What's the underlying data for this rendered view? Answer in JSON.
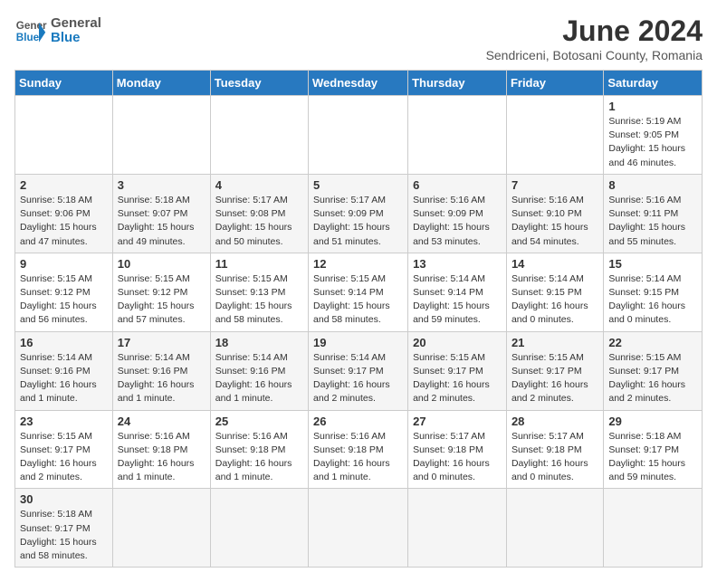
{
  "logo": {
    "text_general": "General",
    "text_blue": "Blue"
  },
  "title": {
    "month_year": "June 2024",
    "location": "Sendriceni, Botosani County, Romania"
  },
  "days_of_week": [
    "Sunday",
    "Monday",
    "Tuesday",
    "Wednesday",
    "Thursday",
    "Friday",
    "Saturday"
  ],
  "weeks": [
    [
      {
        "day": "",
        "info": ""
      },
      {
        "day": "",
        "info": ""
      },
      {
        "day": "",
        "info": ""
      },
      {
        "day": "",
        "info": ""
      },
      {
        "day": "",
        "info": ""
      },
      {
        "day": "",
        "info": ""
      },
      {
        "day": "1",
        "info": "Sunrise: 5:19 AM\nSunset: 9:05 PM\nDaylight: 15 hours\nand 46 minutes."
      }
    ],
    [
      {
        "day": "2",
        "info": "Sunrise: 5:18 AM\nSunset: 9:06 PM\nDaylight: 15 hours\nand 47 minutes."
      },
      {
        "day": "3",
        "info": "Sunrise: 5:18 AM\nSunset: 9:07 PM\nDaylight: 15 hours\nand 49 minutes."
      },
      {
        "day": "4",
        "info": "Sunrise: 5:17 AM\nSunset: 9:08 PM\nDaylight: 15 hours\nand 50 minutes."
      },
      {
        "day": "5",
        "info": "Sunrise: 5:17 AM\nSunset: 9:09 PM\nDaylight: 15 hours\nand 51 minutes."
      },
      {
        "day": "6",
        "info": "Sunrise: 5:16 AM\nSunset: 9:09 PM\nDaylight: 15 hours\nand 53 minutes."
      },
      {
        "day": "7",
        "info": "Sunrise: 5:16 AM\nSunset: 9:10 PM\nDaylight: 15 hours\nand 54 minutes."
      },
      {
        "day": "8",
        "info": "Sunrise: 5:16 AM\nSunset: 9:11 PM\nDaylight: 15 hours\nand 55 minutes."
      }
    ],
    [
      {
        "day": "9",
        "info": "Sunrise: 5:15 AM\nSunset: 9:12 PM\nDaylight: 15 hours\nand 56 minutes."
      },
      {
        "day": "10",
        "info": "Sunrise: 5:15 AM\nSunset: 9:12 PM\nDaylight: 15 hours\nand 57 minutes."
      },
      {
        "day": "11",
        "info": "Sunrise: 5:15 AM\nSunset: 9:13 PM\nDaylight: 15 hours\nand 58 minutes."
      },
      {
        "day": "12",
        "info": "Sunrise: 5:15 AM\nSunset: 9:14 PM\nDaylight: 15 hours\nand 58 minutes."
      },
      {
        "day": "13",
        "info": "Sunrise: 5:14 AM\nSunset: 9:14 PM\nDaylight: 15 hours\nand 59 minutes."
      },
      {
        "day": "14",
        "info": "Sunrise: 5:14 AM\nSunset: 9:15 PM\nDaylight: 16 hours\nand 0 minutes."
      },
      {
        "day": "15",
        "info": "Sunrise: 5:14 AM\nSunset: 9:15 PM\nDaylight: 16 hours\nand 0 minutes."
      }
    ],
    [
      {
        "day": "16",
        "info": "Sunrise: 5:14 AM\nSunset: 9:16 PM\nDaylight: 16 hours\nand 1 minute."
      },
      {
        "day": "17",
        "info": "Sunrise: 5:14 AM\nSunset: 9:16 PM\nDaylight: 16 hours\nand 1 minute."
      },
      {
        "day": "18",
        "info": "Sunrise: 5:14 AM\nSunset: 9:16 PM\nDaylight: 16 hours\nand 1 minute."
      },
      {
        "day": "19",
        "info": "Sunrise: 5:14 AM\nSunset: 9:17 PM\nDaylight: 16 hours\nand 2 minutes."
      },
      {
        "day": "20",
        "info": "Sunrise: 5:15 AM\nSunset: 9:17 PM\nDaylight: 16 hours\nand 2 minutes."
      },
      {
        "day": "21",
        "info": "Sunrise: 5:15 AM\nSunset: 9:17 PM\nDaylight: 16 hours\nand 2 minutes."
      },
      {
        "day": "22",
        "info": "Sunrise: 5:15 AM\nSunset: 9:17 PM\nDaylight: 16 hours\nand 2 minutes."
      }
    ],
    [
      {
        "day": "23",
        "info": "Sunrise: 5:15 AM\nSunset: 9:17 PM\nDaylight: 16 hours\nand 2 minutes."
      },
      {
        "day": "24",
        "info": "Sunrise: 5:16 AM\nSunset: 9:18 PM\nDaylight: 16 hours\nand 1 minute."
      },
      {
        "day": "25",
        "info": "Sunrise: 5:16 AM\nSunset: 9:18 PM\nDaylight: 16 hours\nand 1 minute."
      },
      {
        "day": "26",
        "info": "Sunrise: 5:16 AM\nSunset: 9:18 PM\nDaylight: 16 hours\nand 1 minute."
      },
      {
        "day": "27",
        "info": "Sunrise: 5:17 AM\nSunset: 9:18 PM\nDaylight: 16 hours\nand 0 minutes."
      },
      {
        "day": "28",
        "info": "Sunrise: 5:17 AM\nSunset: 9:18 PM\nDaylight: 16 hours\nand 0 minutes."
      },
      {
        "day": "29",
        "info": "Sunrise: 5:18 AM\nSunset: 9:17 PM\nDaylight: 15 hours\nand 59 minutes."
      }
    ],
    [
      {
        "day": "30",
        "info": "Sunrise: 5:18 AM\nSunset: 9:17 PM\nDaylight: 15 hours\nand 58 minutes."
      },
      {
        "day": "",
        "info": ""
      },
      {
        "day": "",
        "info": ""
      },
      {
        "day": "",
        "info": ""
      },
      {
        "day": "",
        "info": ""
      },
      {
        "day": "",
        "info": ""
      },
      {
        "day": "",
        "info": ""
      }
    ]
  ]
}
